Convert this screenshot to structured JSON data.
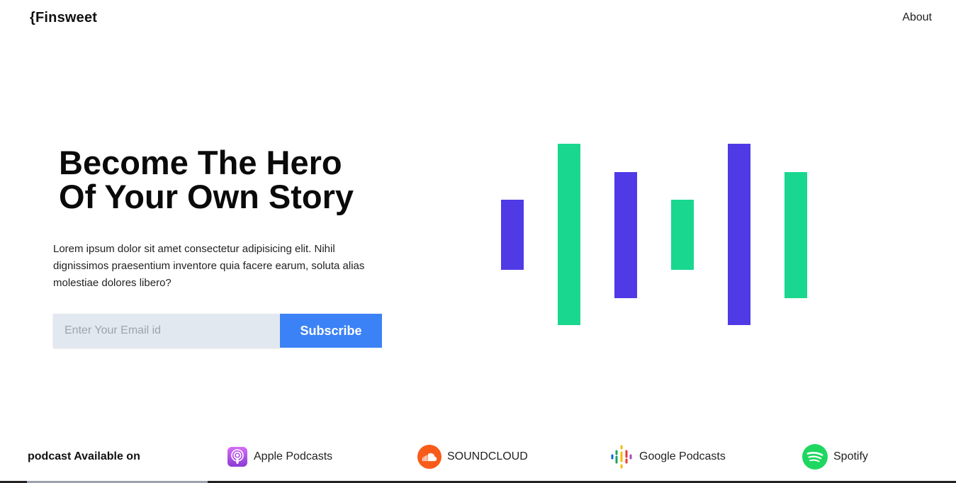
{
  "header": {
    "logo": "{Finsweet",
    "nav_about": "About"
  },
  "hero": {
    "title_line1": "Become The Hero",
    "title_line2": "Of Your Own Story",
    "description": "Lorem ipsum dolor sit amet consectetur adipisicing elit. Nihil dignissimos praesentium inventore quia facere earum, soluta alias molestiae dolores libero?",
    "email_placeholder": "Enter Your Email id",
    "subscribe_label": "Subscribe"
  },
  "colors": {
    "accent_blue": "#3b82f6",
    "bar_purple": "#4f3ae6",
    "bar_green": "#19d78f",
    "input_bg": "#e2e8f0"
  },
  "footer": {
    "available_label": "podcast Available on",
    "platforms": [
      {
        "name": "Apple Podcasts",
        "icon": "apple-podcasts-icon"
      },
      {
        "name": "SOUNDCLOUD",
        "icon": "soundcloud-icon"
      },
      {
        "name": "Google Podcasts",
        "icon": "google-podcasts-icon"
      },
      {
        "name": "Spotify",
        "icon": "spotify-icon"
      }
    ]
  }
}
